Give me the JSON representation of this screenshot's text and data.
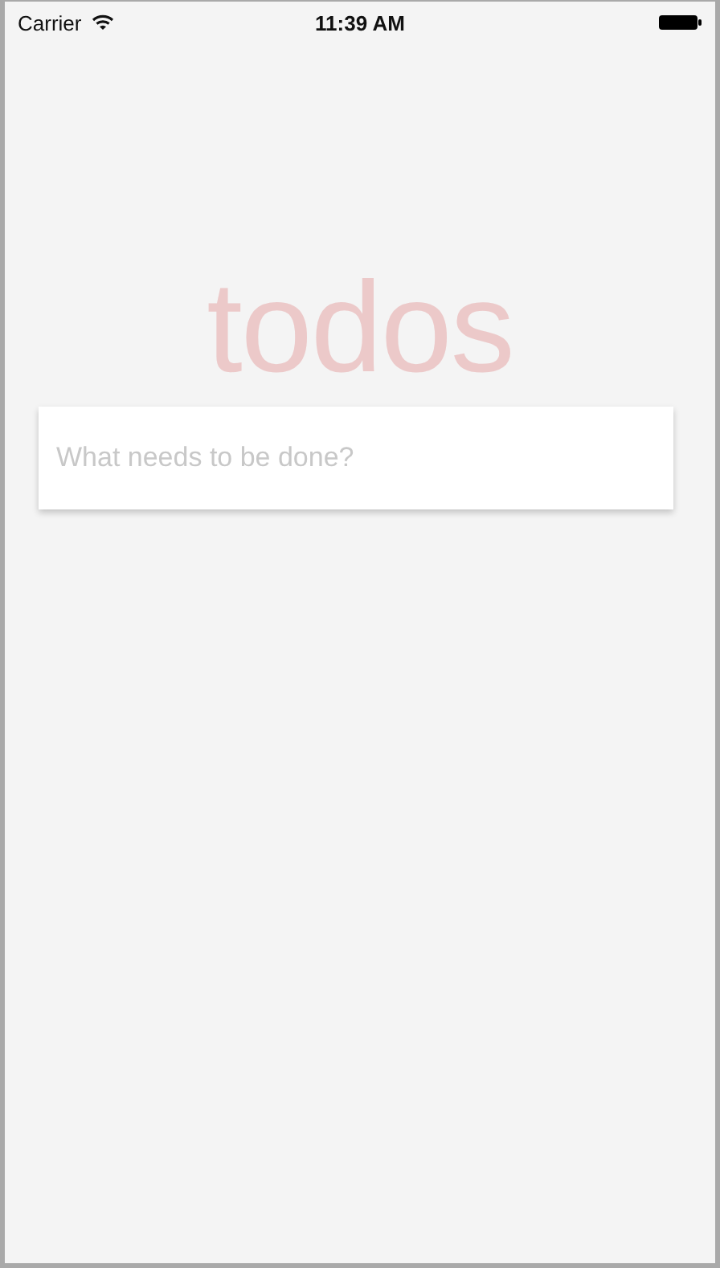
{
  "status_bar": {
    "carrier": "Carrier",
    "time": "11:39 AM"
  },
  "title": "todos",
  "new_todo": {
    "placeholder": "What needs to be done?"
  }
}
